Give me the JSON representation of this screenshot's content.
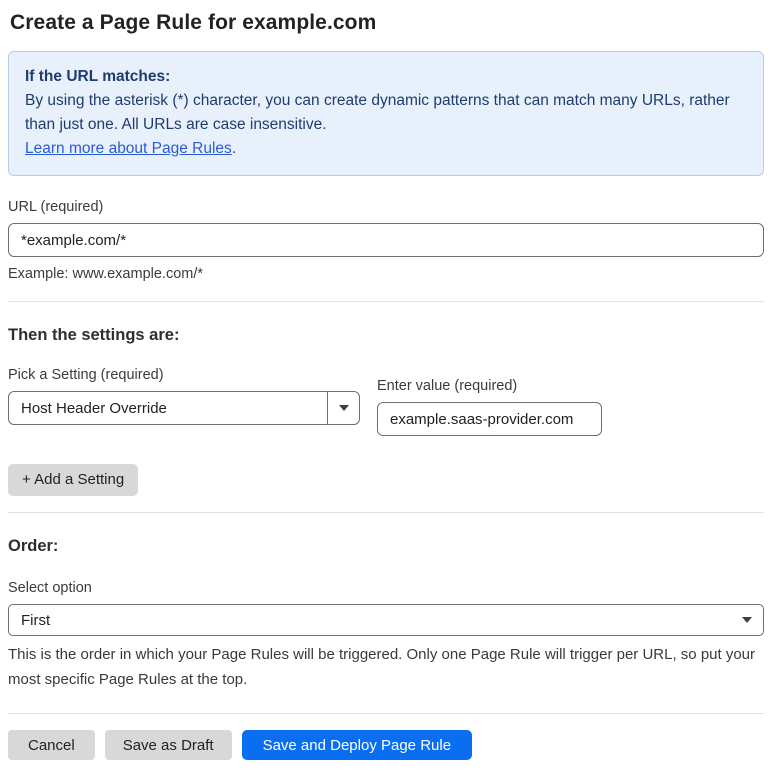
{
  "page": {
    "title": "Create a Page Rule for example.com"
  },
  "info_box": {
    "heading": "If the URL matches:",
    "body": "By using the asterisk (*) character, you can create dynamic patterns that can match many URLs, rather than just one. All URLs are case insensitive.",
    "link_label": "Learn more about Page Rules",
    "link_suffix": "."
  },
  "url_field": {
    "label": "URL (required)",
    "value": "*example.com/*",
    "helper": "Example: www.example.com/*"
  },
  "settings_section": {
    "heading": "Then the settings are:",
    "setting_select": {
      "label": "Pick a Setting (required)",
      "selected_value": "Host Header Override"
    },
    "value_field": {
      "label": "Enter value (required)",
      "value": "example.saas-provider.com"
    },
    "add_button_label": "+ Add a Setting"
  },
  "order_section": {
    "heading": "Order:",
    "select_label": "Select option",
    "selected_option": "First",
    "helper": "This is the order in which your Page Rules will be triggered. Only one Page Rule will trigger per URL, so put your most specific Page Rules at the top."
  },
  "footer": {
    "cancel_label": "Cancel",
    "save_draft_label": "Save as Draft",
    "save_deploy_label": "Save and Deploy Page Rule"
  },
  "colors": {
    "primary_button": "#0a6ef0",
    "info_box_bg": "#e8f1fb",
    "info_box_border": "#b3cde9",
    "info_box_text": "#1e3c6e",
    "link": "#2a5bd7",
    "gray_button_bg": "#d8d8d8",
    "input_border": "#6f6f6f",
    "divider": "#e2e2e2"
  }
}
